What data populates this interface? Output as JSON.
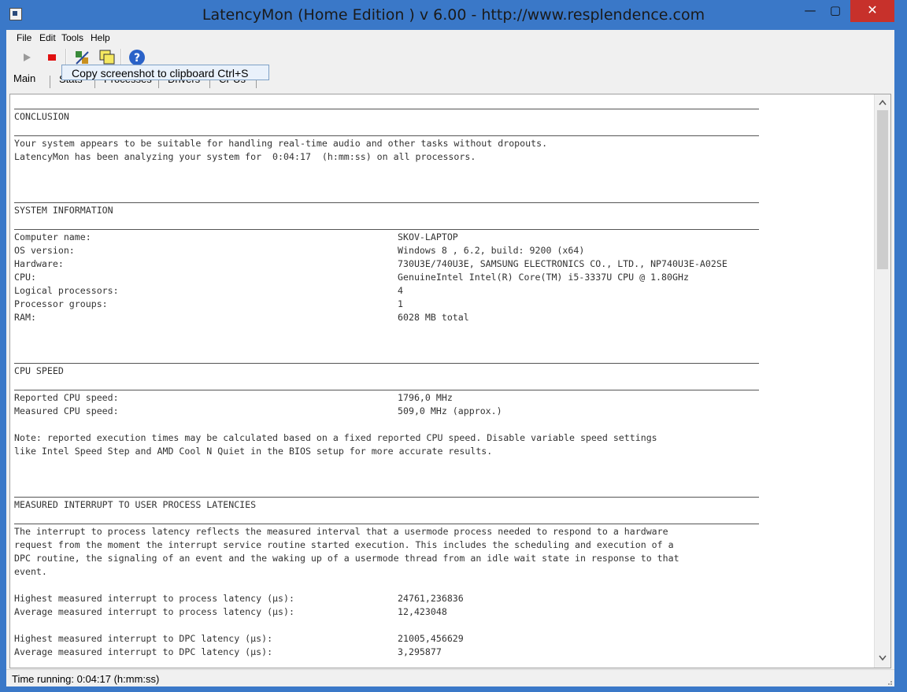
{
  "window": {
    "title": "LatencyMon  (Home Edition )  v 6.00 - http://www.resplendence.com",
    "minimize": "—",
    "maximize": "▢",
    "close": "✕"
  },
  "menu": {
    "file": "File",
    "edit": "Edit",
    "tools": "Tools",
    "help": "Help"
  },
  "toolbar": {
    "tooltip": "Copy screenshot to clipboard Ctrl+S",
    "icons": [
      "play-icon",
      "stop-icon",
      "tools-icon",
      "screenshot-icon",
      "help-icon"
    ]
  },
  "tabs": {
    "main": "Main",
    "stats": "Stats",
    "processes": "Processes",
    "drivers": "Drivers",
    "cpus": "CPUs"
  },
  "report": {
    "conclusion": {
      "heading": "CONCLUSION",
      "line1": "Your system appears to be suitable for handling real-time audio and other tasks without dropouts.",
      "line2": "LatencyMon has been analyzing your system for  0:04:17  (h:mm:ss) on all processors."
    },
    "sysinfo": {
      "heading": "SYSTEM INFORMATION",
      "rows": [
        {
          "label": "Computer name:",
          "value": "SKOV-LAPTOP"
        },
        {
          "label": "OS version:",
          "value": "Windows 8 , 6.2, build: 9200 (x64)"
        },
        {
          "label": "Hardware:",
          "value": "730U3E/740U3E, SAMSUNG ELECTRONICS CO., LTD., NP740U3E-A02SE"
        },
        {
          "label": "CPU:",
          "value": "GenuineIntel Intel(R) Core(TM) i5-3337U CPU @ 1.80GHz"
        },
        {
          "label": "Logical processors:",
          "value": "4"
        },
        {
          "label": "Processor groups:",
          "value": "1"
        },
        {
          "label": "RAM:",
          "value": "6028 MB total"
        }
      ]
    },
    "cpuspeed": {
      "heading": "CPU SPEED",
      "rows": [
        {
          "label": "Reported CPU speed:",
          "value": "1796,0 MHz"
        },
        {
          "label": "Measured CPU speed:",
          "value": "509,0 MHz (approx.)"
        }
      ],
      "note1": "Note: reported execution times may be calculated based on a fixed reported CPU speed. Disable variable speed settings",
      "note2": "like Intel Speed Step and AMD Cool N Quiet in the BIOS setup for more accurate results."
    },
    "interrupt": {
      "heading": "MEASURED INTERRUPT TO USER PROCESS LATENCIES",
      "desc1": "The interrupt to process latency reflects the measured interval that a usermode process needed to respond to a hardware",
      "desc2": "request from the moment the interrupt service routine started execution. This includes the scheduling and execution of a",
      "desc3": "DPC routine, the signaling of an event and the waking up of a usermode thread from an idle wait state in response to that",
      "desc4": "event.",
      "rows": [
        {
          "label": "Highest measured interrupt to process latency (µs):",
          "value": "24761,236836"
        },
        {
          "label": "Average measured interrupt to process latency (µs):",
          "value": "12,423048"
        },
        {
          "label": "Highest measured interrupt to DPC latency (µs):",
          "value": "21005,456629"
        },
        {
          "label": "Average measured interrupt to DPC latency (µs):",
          "value": "3,295877"
        }
      ]
    }
  },
  "status": {
    "text": "Time running: 0:04:17  (h:mm:ss)"
  }
}
